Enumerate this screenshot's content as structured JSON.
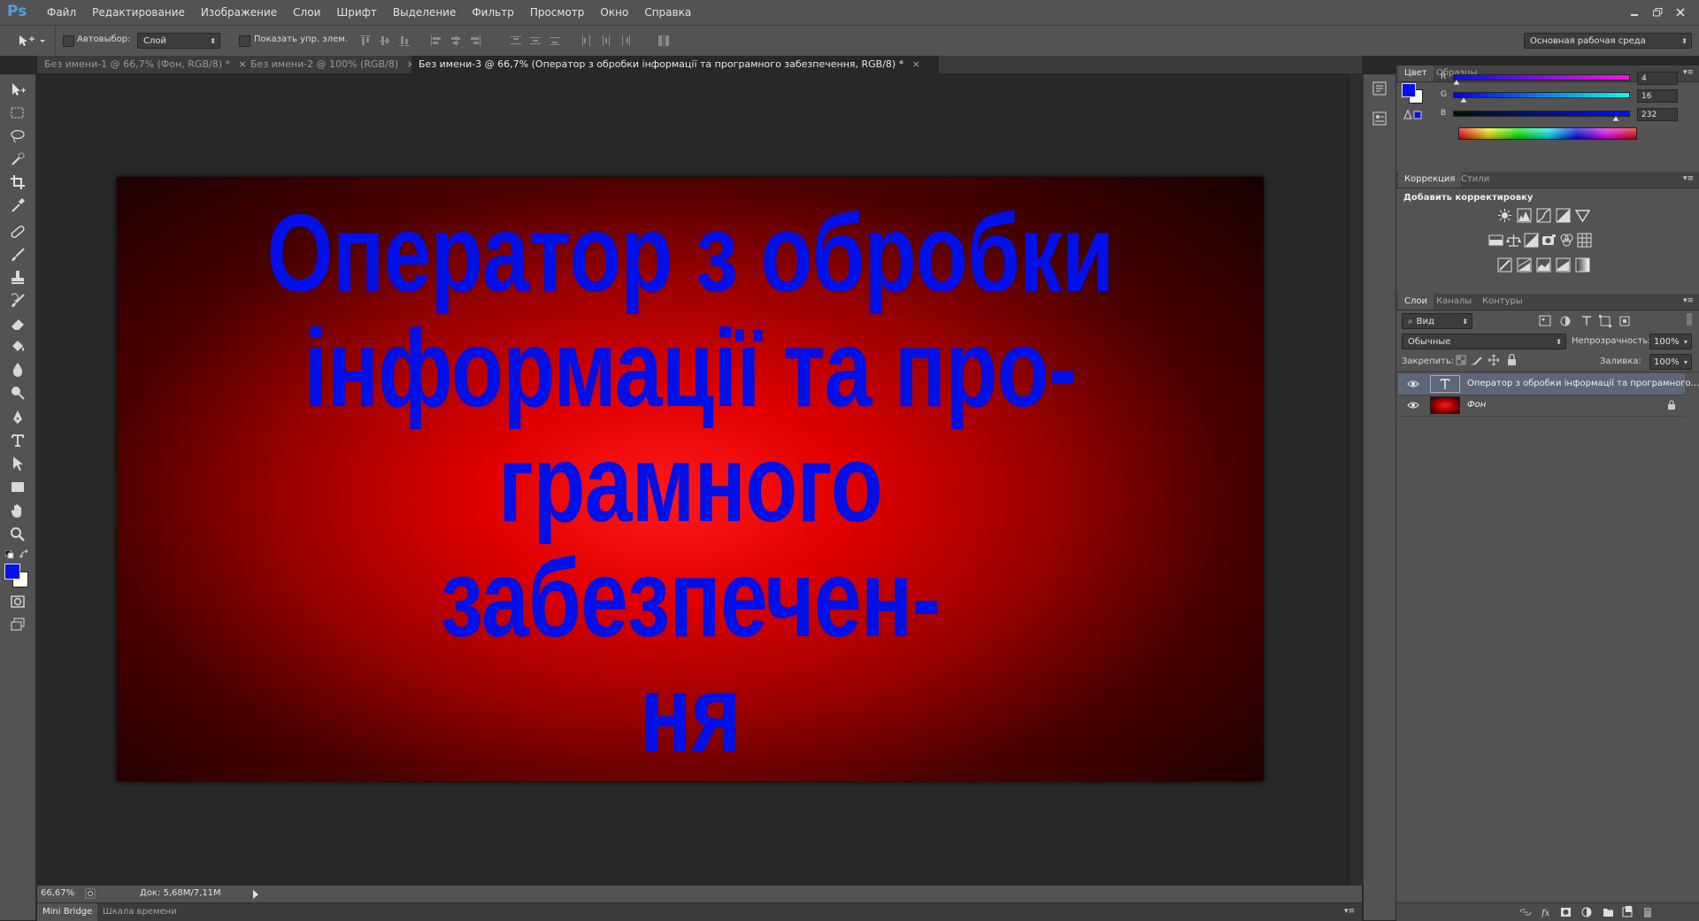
{
  "app": {
    "logo": "Ps"
  },
  "menu": [
    "Файл",
    "Редактирование",
    "Изображение",
    "Слои",
    "Шрифт",
    "Выделение",
    "Фильтр",
    "Просмотр",
    "Окно",
    "Справка"
  ],
  "options": {
    "autoselect_label": "Автовыбор:",
    "autoselect_value": "Слой",
    "show_transform_label": "Показать упр. элем.",
    "workspace": "Основная рабочая среда"
  },
  "tabs": [
    {
      "label": "Без имени-1 @ 66,7% (Фон, RGB/8) *",
      "active": false
    },
    {
      "label": "Без имени-2 @ 100% (RGB/8)",
      "active": false
    },
    {
      "label": "Без имени-3 @ 66,7% (Оператор з обробки інформації та програмного забезпечення, RGB/8) *",
      "active": true
    }
  ],
  "document": {
    "lines": [
      "Оператор з обробки",
      "інформації та про-",
      "грамного забезпечен-",
      "ня"
    ],
    "text_color": "#0010e6"
  },
  "status": {
    "zoom": "66,67%",
    "doc_size": "Док: 5,68M/7,11M"
  },
  "bottom_tabs": [
    "Mini Bridge",
    "Шкала времени"
  ],
  "color_panel": {
    "tabs": [
      "Цвет",
      "Образцы"
    ],
    "r_label": "R",
    "g_label": "G",
    "b_label": "B",
    "r": "4",
    "g": "16",
    "b": "232",
    "foreground": "#0410e8",
    "background": "#ffffff"
  },
  "adjust_panel": {
    "tabs": [
      "Коррекция",
      "Стили"
    ],
    "title": "Добавить корректировку"
  },
  "layers_panel": {
    "tabs": [
      "Слои",
      "Каналы",
      "Контуры"
    ],
    "filter": "Вид",
    "blend_mode": "Обычные",
    "opacity_label": "Непрозрачность:",
    "opacity": "100%",
    "lock_label": "Закрепить:",
    "fill_label": "Заливка:",
    "fill": "100%",
    "layers": [
      {
        "name": "Оператор з обробки інформації та програмного...",
        "type": "text",
        "selected": true
      },
      {
        "name": "Фон",
        "type": "background",
        "selected": false
      }
    ]
  }
}
